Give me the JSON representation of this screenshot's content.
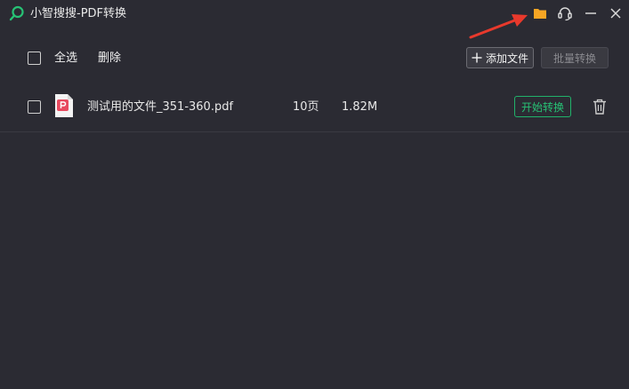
{
  "window": {
    "title": "小智搜搜-PDF转换",
    "icons": [
      "search-logo-icon",
      "folder-icon",
      "headset-icon",
      "minimize-icon",
      "close-icon"
    ],
    "colors": {
      "background": "#2b2b33",
      "accent_green": "#27c275",
      "folder": "#f5a524",
      "annotation_arrow": "#e8392c"
    }
  },
  "toolbar": {
    "select_all_label": "全选",
    "delete_label": "删除",
    "add_file_label": "添加文件",
    "batch_convert_label": "批量转换"
  },
  "files": [
    {
      "name": "测试用的文件_351-360.pdf",
      "pages": "10页",
      "size": "1.82M",
      "action_label": "开始转换"
    }
  ]
}
